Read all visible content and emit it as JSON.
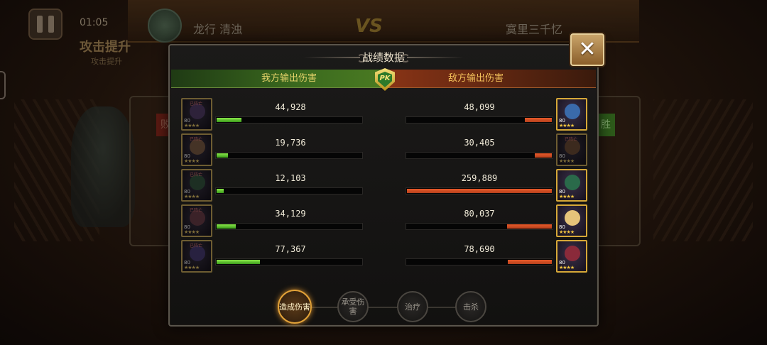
{
  "background": {
    "timer": "01:05",
    "buff_title": "攻击提升",
    "buff_sub": "攻击提升",
    "left_player": "龙行 清浊",
    "vs": "VS",
    "right_player": "寞里三千忆",
    "lose_mark": "败",
    "win_mark": "胜"
  },
  "panel": {
    "title": "战绩数据",
    "close_symbol": "✕",
    "ally_header": "我方输出伤害",
    "enemy_header": "敌方输出伤害",
    "pk_badge": "PK"
  },
  "ally_heroes": [
    {
      "damage": "44,928",
      "ratio": 0.173,
      "level": "80",
      "stars": "★★★★",
      "status": "已阵亡",
      "face_color": "#5a3a7a"
    },
    {
      "damage": "19,736",
      "ratio": 0.076,
      "level": "80",
      "stars": "★★★★",
      "status": "已阵亡",
      "face_color": "#8a5a3a"
    },
    {
      "damage": "12,103",
      "ratio": 0.047,
      "level": "80",
      "stars": "★★★★",
      "status": "已阵亡",
      "face_color": "#2a5a3a"
    },
    {
      "damage": "34,129",
      "ratio": 0.131,
      "level": "80",
      "stars": "★★★★",
      "status": "已阵亡",
      "face_color": "#7a3a4a"
    },
    {
      "damage": "77,367",
      "ratio": 0.298,
      "level": "80",
      "stars": "★★★★",
      "status": "已阵亡",
      "face_color": "#4a3a8a"
    }
  ],
  "enemy_heroes": [
    {
      "damage": "48,099",
      "ratio": 0.185,
      "level": "80",
      "stars": "★★★★",
      "status": "",
      "face_color": "#3a6aaa"
    },
    {
      "damage": "30,405",
      "ratio": 0.117,
      "level": "80",
      "stars": "★★★★",
      "status": "已阵亡",
      "face_color": "#7a4a2a"
    },
    {
      "damage": "259,889",
      "ratio": 1.0,
      "level": "80",
      "stars": "★★★★",
      "status": "",
      "face_color": "#2a6a4a"
    },
    {
      "damage": "80,037",
      "ratio": 0.308,
      "level": "80",
      "stars": "★★★★",
      "status": "",
      "face_color": "#e6c47a"
    },
    {
      "damage": "78,690",
      "ratio": 0.303,
      "level": "80",
      "stars": "★★★★",
      "status": "",
      "face_color": "#8a2a3a"
    }
  ],
  "tabs": [
    {
      "label": "造成伤害",
      "active": true
    },
    {
      "label": "承受伤害",
      "active": false
    },
    {
      "label": "治疗",
      "active": false
    },
    {
      "label": "击杀",
      "active": false
    }
  ],
  "colors": {
    "ally_bar": "#5ac82a",
    "enemy_bar": "#d04a22",
    "avatar_border": "#d6a838",
    "active_tab": "#e2a238"
  }
}
